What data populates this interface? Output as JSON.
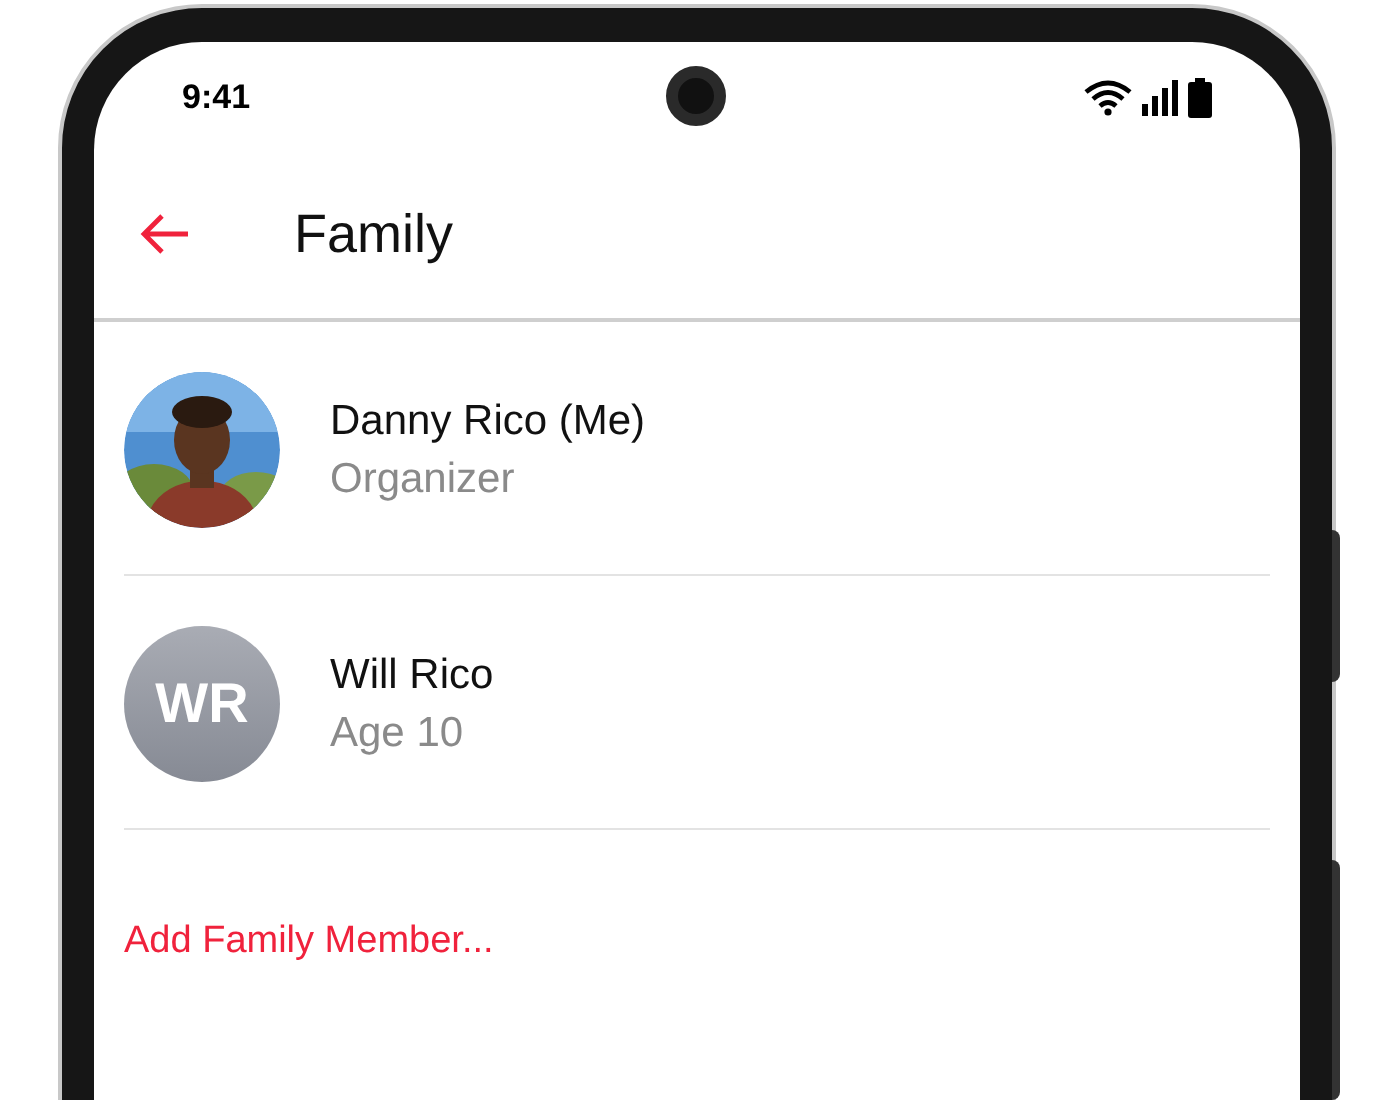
{
  "status_bar": {
    "time": "9:41"
  },
  "header": {
    "title": "Family"
  },
  "members": [
    {
      "name": "Danny Rico (Me)",
      "role": "Organizer"
    },
    {
      "name": "Will Rico",
      "role": "Age 10",
      "avatar": {
        "kind": "initials",
        "initials": "WR"
      }
    }
  ],
  "add_member": "Add Family Member..."
}
